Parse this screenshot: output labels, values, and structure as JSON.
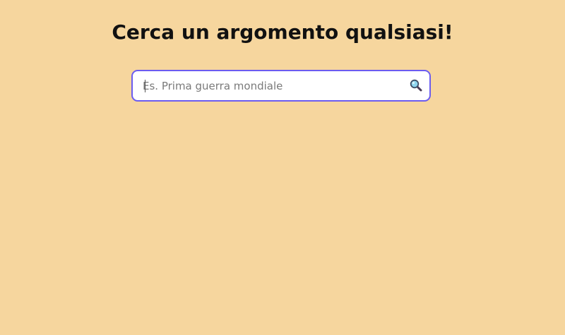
{
  "header": {
    "title": "Cerca un argomento qualsiasi!"
  },
  "search": {
    "placeholder": "Es. Prima guerra mondiale",
    "value": "",
    "icon": "search-icon"
  },
  "colors": {
    "background": "#f6d69e",
    "input_border": "#6b5cf0",
    "input_background": "#ffffff"
  }
}
